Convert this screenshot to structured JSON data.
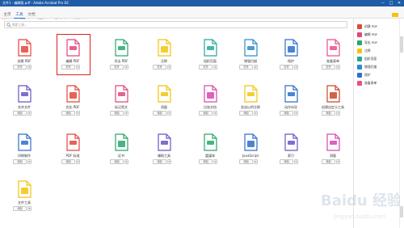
{
  "window": {
    "title": "文件1 - 编辑版.pdf - Adobe Acrobat Pro DC",
    "minimize": "─",
    "maximize": "□",
    "close": "✕"
  },
  "menu": [
    "文件(F)",
    "编辑(E)",
    "视图(V)",
    "窗口(W)",
    "帮助(H)"
  ],
  "tabs": [
    "主页",
    "工具",
    "文档"
  ],
  "active_tab": "工具",
  "search": {
    "placeholder": "搜索工具..."
  },
  "buttons": {
    "open": "打开",
    "add": "添加"
  },
  "tools": [
    {
      "label": "创建 PDF",
      "icon": "create-pdf-icon",
      "button": "打开",
      "color": "#e4473b"
    },
    {
      "label": "编辑 PDF",
      "icon": "edit-pdf-icon",
      "button": "打开",
      "color": "#e1467c"
    },
    {
      "label": "导出 PDF",
      "icon": "export-pdf-icon",
      "button": "打开",
      "color": "#2aa66b"
    },
    {
      "label": "注释",
      "icon": "comment-icon",
      "button": "打开",
      "color": "#f2c40e"
    },
    {
      "label": "组织页面",
      "icon": "organize-pages-icon",
      "button": "打开",
      "color": "#23a99b"
    },
    {
      "label": "增强扫描",
      "icon": "enhance-scans-icon",
      "button": "打开",
      "color": "#2e8acb"
    },
    {
      "label": "保护",
      "icon": "protect-icon",
      "button": "打开",
      "color": "#2e6fca"
    },
    {
      "label": "准备表单",
      "icon": "prepare-form-icon",
      "button": "打开",
      "color": "#e94f8e"
    },
    {
      "label": "合并文件",
      "icon": "combine-files-icon",
      "button": "添加",
      "color": "#6a55c8"
    },
    {
      "label": "优化 PDF",
      "icon": "optimize-pdf-icon",
      "button": "添加",
      "color": "#e4473b"
    },
    {
      "label": "标记密文",
      "icon": "redact-icon",
      "button": "添加",
      "color": "#e1467c"
    },
    {
      "label": "测量",
      "icon": "measure-icon",
      "button": "添加",
      "color": "#f2c40e"
    },
    {
      "label": "比较文档",
      "icon": "compare-files-icon",
      "button": "添加",
      "color": "#d847b0"
    },
    {
      "label": "发送以供注释",
      "icon": "send-comments-icon",
      "button": "添加",
      "color": "#f2c40e"
    },
    {
      "label": "动作向导",
      "icon": "action-wizard-icon",
      "button": "添加",
      "color": "#2e6fca"
    },
    {
      "label": "创建自定义工具",
      "icon": "custom-tool-icon",
      "button": "添加",
      "color": "#c9482a"
    },
    {
      "label": "印刷制作",
      "icon": "print-production-icon",
      "button": "添加",
      "color": "#2e6fca"
    },
    {
      "label": "PDF 标准",
      "icon": "pdf-standards-icon",
      "button": "添加",
      "color": "#e4473b"
    },
    {
      "label": "证书",
      "icon": "certificates-icon",
      "button": "添加",
      "color": "#2aa66b"
    },
    {
      "label": "辅助工具",
      "icon": "accessibility-icon",
      "button": "添加",
      "color": "#6a55c8"
    },
    {
      "label": "富媒体",
      "icon": "rich-media-icon",
      "button": "添加",
      "color": "#2aa66b"
    },
    {
      "label": "JavaScript",
      "icon": "javascript-icon",
      "button": "添加",
      "color": "#2e6fca"
    },
    {
      "label": "索引",
      "icon": "index-icon",
      "button": "添加",
      "color": "#6a55c8"
    },
    {
      "label": "测量",
      "icon": "ruler-icon",
      "button": "添加",
      "color": "#d847b0"
    },
    {
      "label": "文件工具",
      "icon": "file-tools-icon",
      "button": "添加",
      "color": "#f2c40e"
    }
  ],
  "right_panel": [
    {
      "label": "创建 PDF",
      "icon": "create-pdf-icon",
      "color": "#e4473b"
    },
    {
      "label": "编辑 PDF",
      "icon": "edit-pdf-icon",
      "color": "#e1467c"
    },
    {
      "label": "导出 PDF",
      "icon": "export-pdf-icon",
      "color": "#2aa66b"
    },
    {
      "label": "注释",
      "icon": "comment-icon",
      "color": "#f2c40e"
    },
    {
      "label": "组织页面",
      "icon": "organize-pages-icon",
      "color": "#23a99b"
    },
    {
      "label": "增强扫描",
      "icon": "enhance-scans-icon",
      "color": "#2e8acb"
    },
    {
      "label": "保护",
      "icon": "protect-icon",
      "color": "#2e6fca"
    },
    {
      "label": "准备表单",
      "icon": "prepare-form-icon",
      "color": "#e94f8e"
    }
  ],
  "watermark": {
    "text": "Baidu 经验",
    "sub": "jingyan.baidu.com"
  }
}
